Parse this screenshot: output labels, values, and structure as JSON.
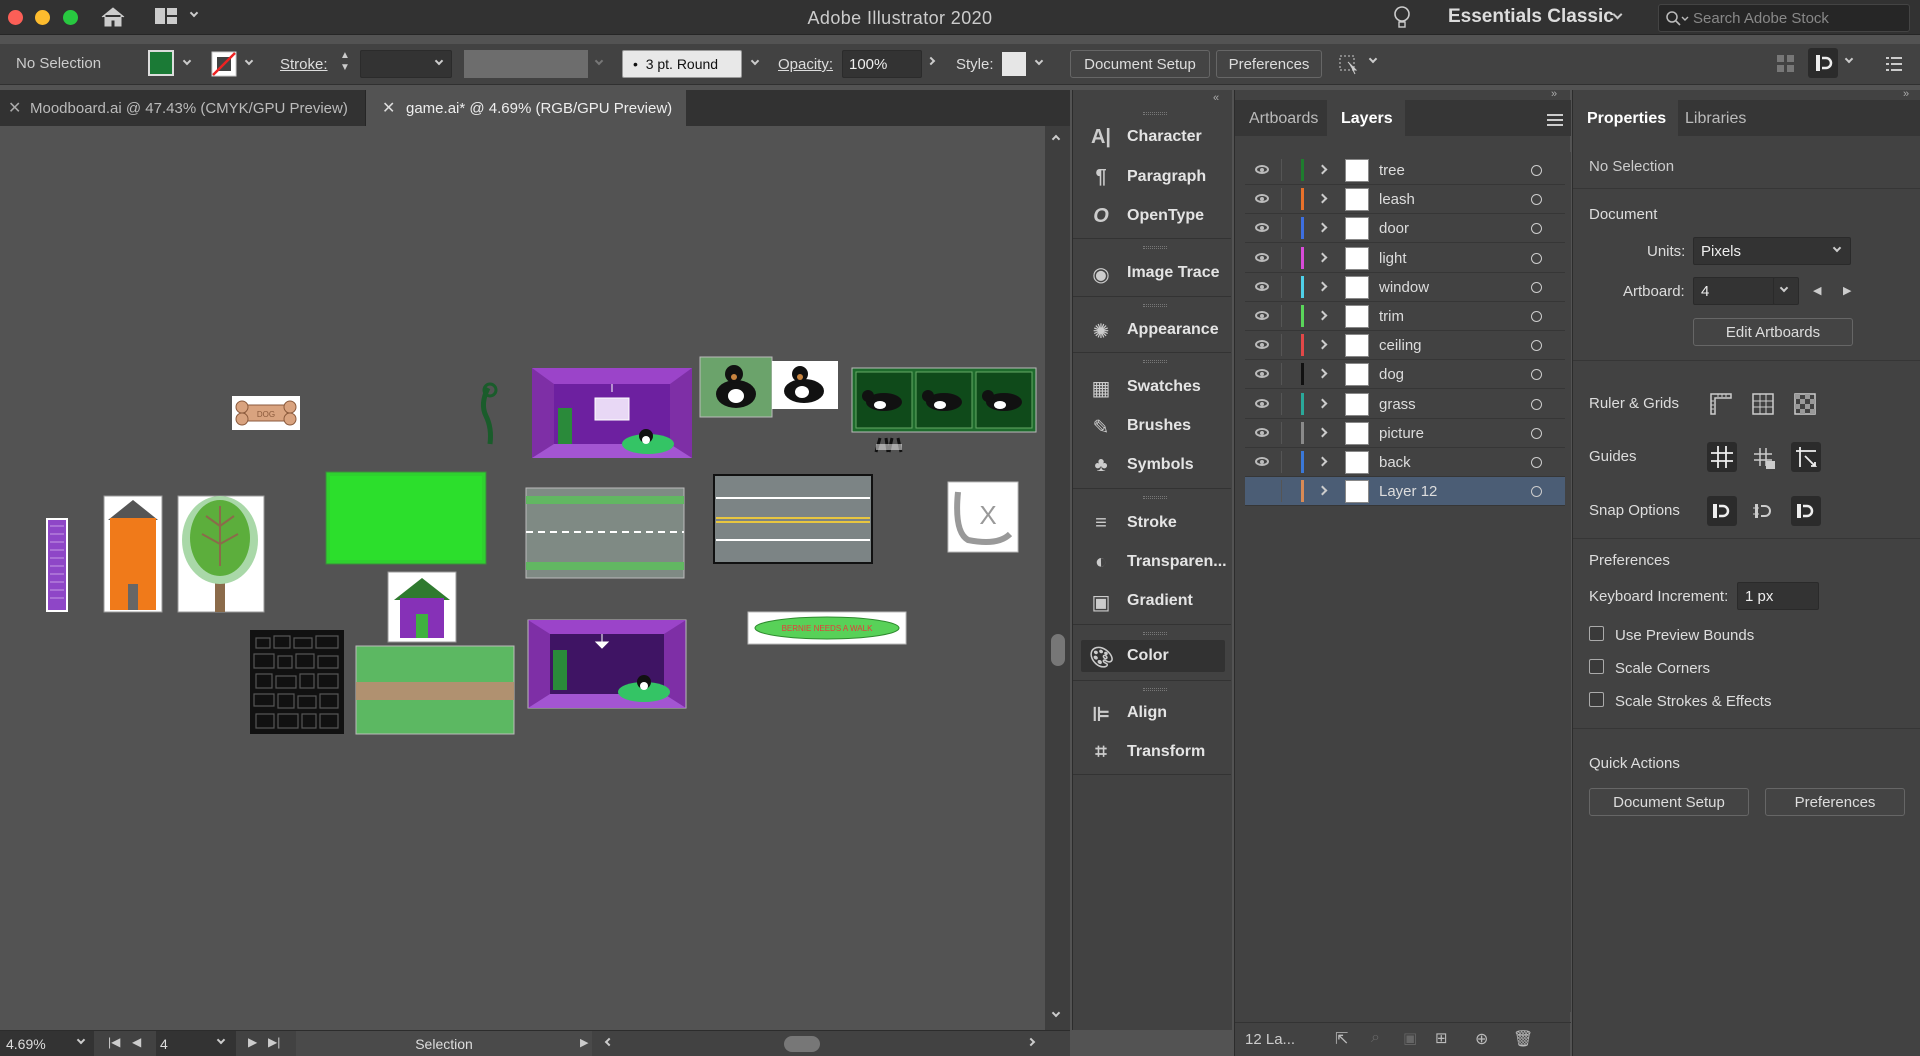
{
  "app": {
    "title": "Adobe Illustrator 2020",
    "workspace": "Essentials Classic",
    "search_placeholder": "Search Adobe Stock"
  },
  "control": {
    "selection_label": "No Selection",
    "fill_color": "#1b7a36",
    "stroke_label": "Stroke:",
    "brush": "3 pt. Round",
    "opacity_label": "Opacity:",
    "opacity_value": "100%",
    "style_label": "Style:",
    "document_setup": "Document Setup",
    "preferences": "Preferences"
  },
  "tabs": [
    {
      "label": "Moodboard.ai @ 47.43% (CMYK/GPU Preview)",
      "active": false
    },
    {
      "label": "game.ai* @ 4.69% (RGB/GPU Preview)",
      "active": true
    }
  ],
  "status": {
    "zoom": "4.69%",
    "artboard": "4",
    "tool": "Selection"
  },
  "panels": [
    {
      "group": 1,
      "items": [
        {
          "label": "Character",
          "icon": "character-icon"
        },
        {
          "label": "Paragraph",
          "icon": "paragraph-icon"
        },
        {
          "label": "OpenType",
          "icon": "opentype-icon"
        }
      ]
    },
    {
      "group": 2,
      "items": [
        {
          "label": "Image Trace",
          "icon": "image-trace-icon"
        }
      ]
    },
    {
      "group": 3,
      "items": [
        {
          "label": "Appearance",
          "icon": "appearance-icon"
        }
      ]
    },
    {
      "group": 4,
      "items": [
        {
          "label": "Swatches",
          "icon": "swatches-icon"
        },
        {
          "label": "Brushes",
          "icon": "brushes-icon"
        },
        {
          "label": "Symbols",
          "icon": "symbols-icon"
        }
      ]
    },
    {
      "group": 5,
      "items": [
        {
          "label": "Stroke",
          "icon": "stroke-icon"
        },
        {
          "label": "Transparen...",
          "icon": "transparency-icon"
        },
        {
          "label": "Gradient",
          "icon": "gradient-icon"
        }
      ]
    },
    {
      "group": 6,
      "items": [
        {
          "label": "Color",
          "icon": "color-icon"
        }
      ]
    },
    {
      "group": 7,
      "items": [
        {
          "label": "Align",
          "icon": "align-icon"
        },
        {
          "label": "Transform",
          "icon": "transform-icon"
        }
      ]
    }
  ],
  "layers_panel": {
    "tabs": [
      "Artboards",
      "Layers"
    ],
    "active_tab": "Layers",
    "count_label": "12 La...",
    "layers": [
      {
        "name": "tree",
        "color": "#1e7d2e",
        "selected": false
      },
      {
        "name": "leash",
        "color": "#e8712a",
        "selected": false
      },
      {
        "name": "door",
        "color": "#3d6fe0",
        "selected": false
      },
      {
        "name": "light",
        "color": "#d94bd9",
        "selected": false
      },
      {
        "name": "window",
        "color": "#4fd0e8",
        "selected": false
      },
      {
        "name": "trim",
        "color": "#5ad65a",
        "selected": false
      },
      {
        "name": "ceiling",
        "color": "#e24848",
        "selected": false
      },
      {
        "name": "dog",
        "color": "#111111",
        "selected": false
      },
      {
        "name": "grass",
        "color": "#2aa89a",
        "selected": false
      },
      {
        "name": "picture",
        "color": "#8a8a8a",
        "selected": false
      },
      {
        "name": "back",
        "color": "#3a78d8",
        "selected": false
      },
      {
        "name": "Layer 12",
        "color": "#d88a55",
        "selected": true
      }
    ]
  },
  "properties": {
    "tabs": [
      "Properties",
      "Libraries"
    ],
    "no_selection": "No Selection",
    "document_header": "Document",
    "units_label": "Units:",
    "units_value": "Pixels",
    "artboard_label": "Artboard:",
    "artboard_value": "4",
    "edit_artboards": "Edit Artboards",
    "ruler_grids": "Ruler & Grids",
    "guides": "Guides",
    "snap_options": "Snap Options",
    "preferences_header": "Preferences",
    "keyboard_increment_label": "Keyboard Increment:",
    "keyboard_increment_value": "1 px",
    "use_preview_bounds": "Use Preview Bounds",
    "scale_corners": "Scale Corners",
    "scale_strokes": "Scale Strokes & Effects",
    "quick_actions": "Quick Actions",
    "document_setup": "Document Setup",
    "preferences": "Preferences"
  },
  "canvas": {
    "bone_text": "DOG",
    "banner_text": "BERNIE NEEDS A WALK"
  }
}
